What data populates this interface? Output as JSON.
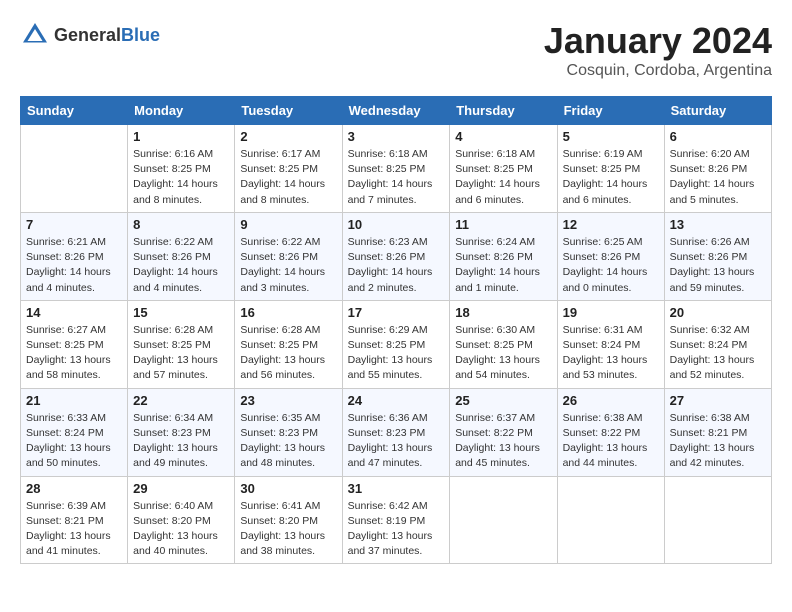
{
  "header": {
    "logo_general": "General",
    "logo_blue": "Blue",
    "month": "January 2024",
    "location": "Cosquin, Cordoba, Argentina"
  },
  "days_of_week": [
    "Sunday",
    "Monday",
    "Tuesday",
    "Wednesday",
    "Thursday",
    "Friday",
    "Saturday"
  ],
  "weeks": [
    [
      {
        "day": "",
        "info": ""
      },
      {
        "day": "1",
        "info": "Sunrise: 6:16 AM\nSunset: 8:25 PM\nDaylight: 14 hours\nand 8 minutes."
      },
      {
        "day": "2",
        "info": "Sunrise: 6:17 AM\nSunset: 8:25 PM\nDaylight: 14 hours\nand 8 minutes."
      },
      {
        "day": "3",
        "info": "Sunrise: 6:18 AM\nSunset: 8:25 PM\nDaylight: 14 hours\nand 7 minutes."
      },
      {
        "day": "4",
        "info": "Sunrise: 6:18 AM\nSunset: 8:25 PM\nDaylight: 14 hours\nand 6 minutes."
      },
      {
        "day": "5",
        "info": "Sunrise: 6:19 AM\nSunset: 8:25 PM\nDaylight: 14 hours\nand 6 minutes."
      },
      {
        "day": "6",
        "info": "Sunrise: 6:20 AM\nSunset: 8:26 PM\nDaylight: 14 hours\nand 5 minutes."
      }
    ],
    [
      {
        "day": "7",
        "info": "Sunrise: 6:21 AM\nSunset: 8:26 PM\nDaylight: 14 hours\nand 4 minutes."
      },
      {
        "day": "8",
        "info": "Sunrise: 6:22 AM\nSunset: 8:26 PM\nDaylight: 14 hours\nand 4 minutes."
      },
      {
        "day": "9",
        "info": "Sunrise: 6:22 AM\nSunset: 8:26 PM\nDaylight: 14 hours\nand 3 minutes."
      },
      {
        "day": "10",
        "info": "Sunrise: 6:23 AM\nSunset: 8:26 PM\nDaylight: 14 hours\nand 2 minutes."
      },
      {
        "day": "11",
        "info": "Sunrise: 6:24 AM\nSunset: 8:26 PM\nDaylight: 14 hours\nand 1 minute."
      },
      {
        "day": "12",
        "info": "Sunrise: 6:25 AM\nSunset: 8:26 PM\nDaylight: 14 hours\nand 0 minutes."
      },
      {
        "day": "13",
        "info": "Sunrise: 6:26 AM\nSunset: 8:26 PM\nDaylight: 13 hours\nand 59 minutes."
      }
    ],
    [
      {
        "day": "14",
        "info": "Sunrise: 6:27 AM\nSunset: 8:25 PM\nDaylight: 13 hours\nand 58 minutes."
      },
      {
        "day": "15",
        "info": "Sunrise: 6:28 AM\nSunset: 8:25 PM\nDaylight: 13 hours\nand 57 minutes."
      },
      {
        "day": "16",
        "info": "Sunrise: 6:28 AM\nSunset: 8:25 PM\nDaylight: 13 hours\nand 56 minutes."
      },
      {
        "day": "17",
        "info": "Sunrise: 6:29 AM\nSunset: 8:25 PM\nDaylight: 13 hours\nand 55 minutes."
      },
      {
        "day": "18",
        "info": "Sunrise: 6:30 AM\nSunset: 8:25 PM\nDaylight: 13 hours\nand 54 minutes."
      },
      {
        "day": "19",
        "info": "Sunrise: 6:31 AM\nSunset: 8:24 PM\nDaylight: 13 hours\nand 53 minutes."
      },
      {
        "day": "20",
        "info": "Sunrise: 6:32 AM\nSunset: 8:24 PM\nDaylight: 13 hours\nand 52 minutes."
      }
    ],
    [
      {
        "day": "21",
        "info": "Sunrise: 6:33 AM\nSunset: 8:24 PM\nDaylight: 13 hours\nand 50 minutes."
      },
      {
        "day": "22",
        "info": "Sunrise: 6:34 AM\nSunset: 8:23 PM\nDaylight: 13 hours\nand 49 minutes."
      },
      {
        "day": "23",
        "info": "Sunrise: 6:35 AM\nSunset: 8:23 PM\nDaylight: 13 hours\nand 48 minutes."
      },
      {
        "day": "24",
        "info": "Sunrise: 6:36 AM\nSunset: 8:23 PM\nDaylight: 13 hours\nand 47 minutes."
      },
      {
        "day": "25",
        "info": "Sunrise: 6:37 AM\nSunset: 8:22 PM\nDaylight: 13 hours\nand 45 minutes."
      },
      {
        "day": "26",
        "info": "Sunrise: 6:38 AM\nSunset: 8:22 PM\nDaylight: 13 hours\nand 44 minutes."
      },
      {
        "day": "27",
        "info": "Sunrise: 6:38 AM\nSunset: 8:21 PM\nDaylight: 13 hours\nand 42 minutes."
      }
    ],
    [
      {
        "day": "28",
        "info": "Sunrise: 6:39 AM\nSunset: 8:21 PM\nDaylight: 13 hours\nand 41 minutes."
      },
      {
        "day": "29",
        "info": "Sunrise: 6:40 AM\nSunset: 8:20 PM\nDaylight: 13 hours\nand 40 minutes."
      },
      {
        "day": "30",
        "info": "Sunrise: 6:41 AM\nSunset: 8:20 PM\nDaylight: 13 hours\nand 38 minutes."
      },
      {
        "day": "31",
        "info": "Sunrise: 6:42 AM\nSunset: 8:19 PM\nDaylight: 13 hours\nand 37 minutes."
      },
      {
        "day": "",
        "info": ""
      },
      {
        "day": "",
        "info": ""
      },
      {
        "day": "",
        "info": ""
      }
    ]
  ]
}
